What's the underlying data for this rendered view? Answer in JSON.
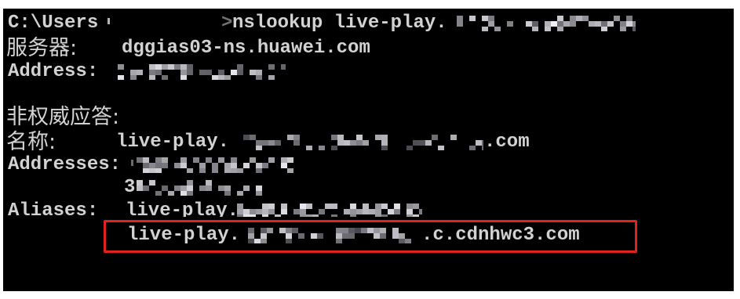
{
  "colors": {
    "page": "#ffffff",
    "console_background": "#000000",
    "text": "#d2d2d2",
    "highlight_border": "#e3221e"
  },
  "console": {
    "command_line": {
      "prompt": "C:\\Users",
      "prompt_end": ">",
      "command": "nslookup live-play."
    },
    "server": {
      "label": "服务器:",
      "value": "dggias03-ns.huawei.com"
    },
    "server_address": {
      "label": "Address:"
    },
    "non_authoritative_answer": {
      "label": "非权威应答:"
    },
    "name": {
      "label": "名称:",
      "value_prefix": "live-play.",
      "value_suffix": ".com"
    },
    "addresses": {
      "label": "Addresses:",
      "second_value_prefix": "3"
    },
    "aliases": {
      "label": "Aliases:",
      "first_value_prefix": "live-play.",
      "second_value_prefix": "live-play.",
      "second_value_suffix": ".c.cdnhwc3.com"
    }
  }
}
